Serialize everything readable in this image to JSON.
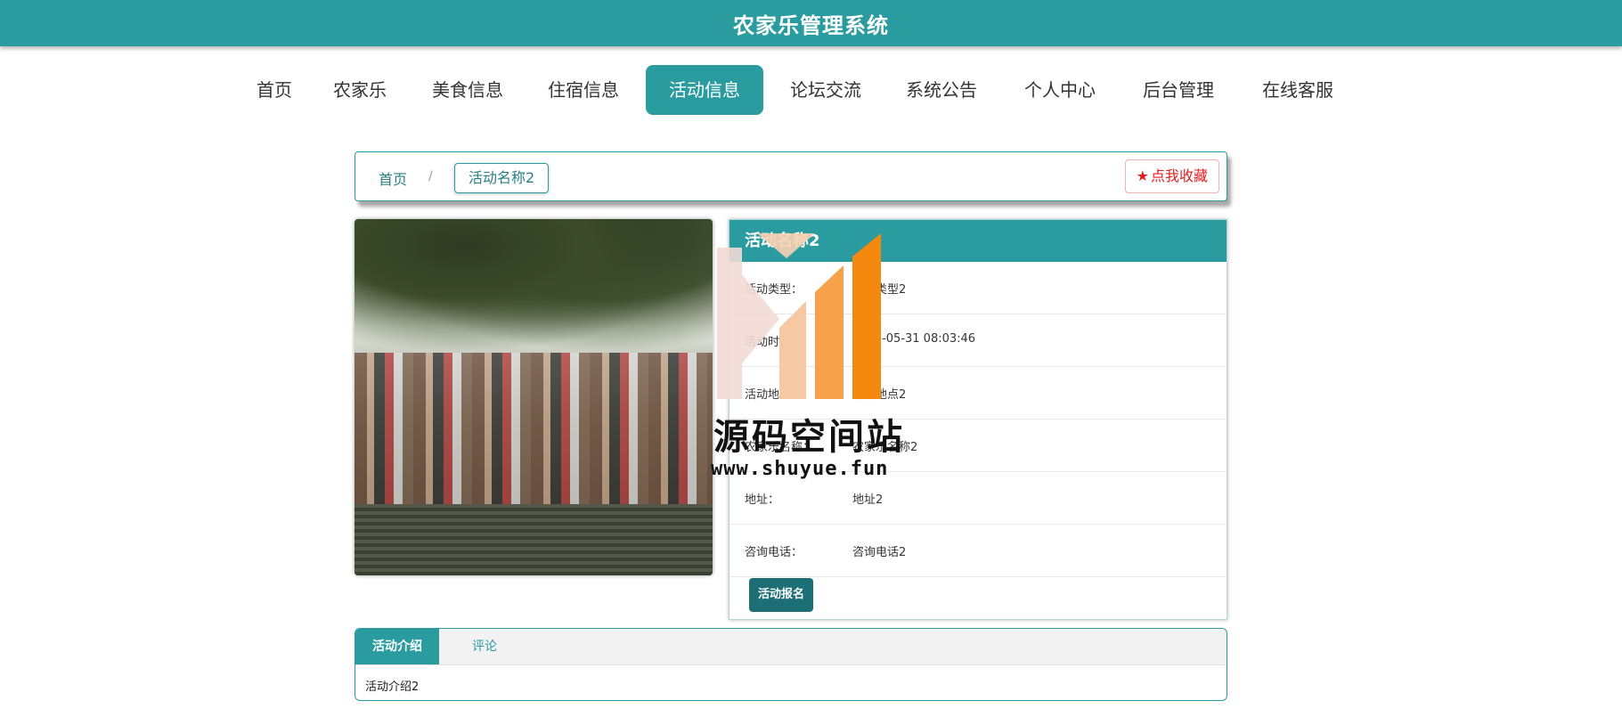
{
  "header": {
    "title": "农家乐管理系统"
  },
  "nav": {
    "items": [
      {
        "label": "首页"
      },
      {
        "label": "农家乐"
      },
      {
        "label": "美食信息"
      },
      {
        "label": "住宿信息"
      },
      {
        "label": "活动信息"
      },
      {
        "label": "论坛交流"
      },
      {
        "label": "系统公告"
      },
      {
        "label": "个人中心"
      },
      {
        "label": "后台管理"
      },
      {
        "label": "在线客服"
      }
    ],
    "active": "活动信息"
  },
  "breadcrumb": {
    "home": "首页",
    "separator": "/",
    "current": "活动名称2",
    "favorite_label": "点我收藏",
    "favorite_icon": "star-icon"
  },
  "detail": {
    "title": "活动名称2",
    "fields": [
      {
        "label": "活动类型：",
        "value": "活动类型2"
      },
      {
        "label": "活动时间：",
        "value": "2023-05-31 08:03:46"
      },
      {
        "label": "活动地点：",
        "value": "活动地点2"
      },
      {
        "label": "农家乐名称：",
        "value": "农家乐名称2"
      },
      {
        "label": "地址：",
        "value": "地址2"
      },
      {
        "label": "咨询电话：",
        "value": "咨询电话2"
      }
    ],
    "apply_label": "活动报名"
  },
  "tabs": {
    "items": [
      {
        "label": "活动介绍"
      },
      {
        "label": "评论"
      }
    ],
    "content": "活动介绍2"
  },
  "watermark": {
    "text": "源码空间站",
    "url": "www.shuyue.fun"
  },
  "colors": {
    "primary": "#2a9c9f",
    "button_dark": "#1b6f75",
    "favorite": "#e02020",
    "watermark_orange": "#f5890f"
  }
}
